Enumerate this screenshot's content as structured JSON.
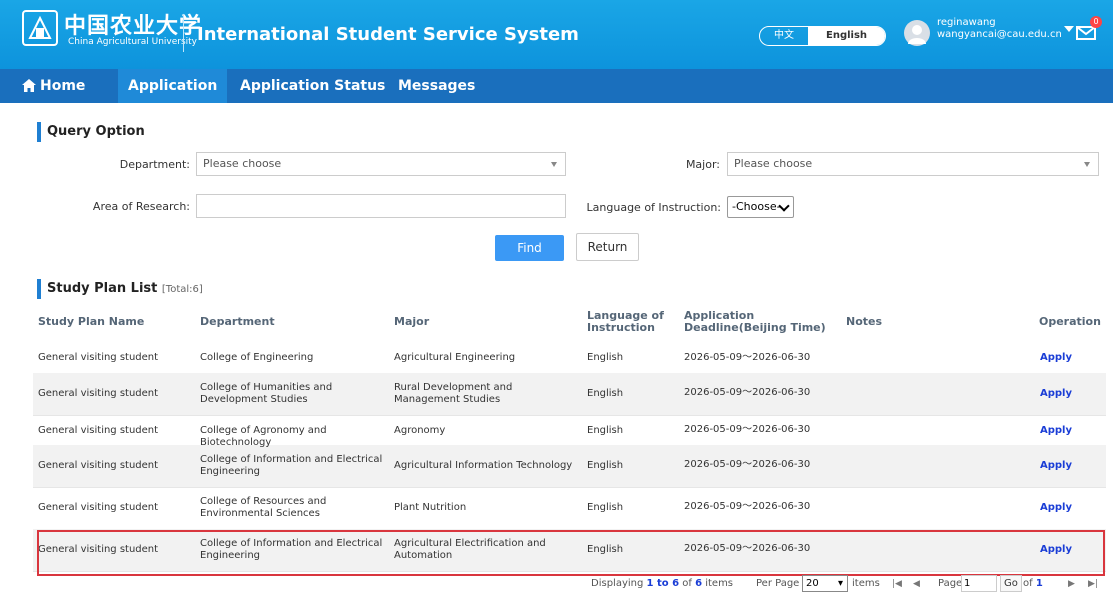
{
  "header": {
    "university_cn": "中国农业大学",
    "university_en": "China Agricultural University",
    "system_title": "International Student Service System",
    "lang_options": [
      "中文",
      "English"
    ],
    "lang_active": "English",
    "user_name": "reginawang",
    "user_email": "wangyancai@cau.edu.cn",
    "message_count": "0"
  },
  "nav": {
    "items": [
      "Home",
      "Application",
      "Application Status",
      "Messages"
    ],
    "active": "Application"
  },
  "query": {
    "title": "Query Option",
    "department_label": "Department:",
    "department_value": "Please choose",
    "major_label": "Major:",
    "major_value": "Please choose",
    "area_label": "Area of Research:",
    "area_value": "",
    "language_label": "Language of Instruction:",
    "language_value": "-Choose-",
    "find_label": "Find",
    "return_label": "Return"
  },
  "list": {
    "title": "Study Plan List",
    "total": "[Total:6]",
    "columns": [
      "Study Plan Name",
      "Department",
      "Major",
      "Language of Instruction",
      "Application Deadline(Beijing Time)",
      "Notes",
      "Operation"
    ],
    "rows": [
      {
        "name": "General visiting student",
        "department": "College of Engineering",
        "major": "Agricultural Engineering",
        "language": "English",
        "deadline": "2026-05-09～2026-06-30",
        "notes": "",
        "operation": "Apply"
      },
      {
        "name": "General visiting student",
        "department": "College of Humanities and Development Studies",
        "major": "Rural Development and Management Studies",
        "language": "English",
        "deadline": "2026-05-09～2026-06-30",
        "notes": "",
        "operation": "Apply"
      },
      {
        "name": "General visiting student",
        "department": "College of Agronomy and Biotechnology",
        "major": "Agronomy",
        "language": "English",
        "deadline": "2026-05-09～2026-06-30",
        "notes": "",
        "operation": "Apply"
      },
      {
        "name": "General visiting student",
        "department": "College of Information and Electrical Engineering",
        "major": "Agricultural Information Technology",
        "language": "English",
        "deadline": "2026-05-09～2026-06-30",
        "notes": "",
        "operation": "Apply"
      },
      {
        "name": "General visiting student",
        "department": "College of Resources and Environmental Sciences",
        "major": "Plant Nutrition",
        "language": "English",
        "deadline": "2026-05-09～2026-06-30",
        "notes": "",
        "operation": "Apply"
      },
      {
        "name": "General visiting student",
        "department": "College of Information and Electrical Engineering",
        "major": "Agricultural Electrification and Automation",
        "language": "English",
        "deadline": "2026-05-09～2026-06-30",
        "notes": "",
        "operation": "Apply"
      }
    ]
  },
  "pager": {
    "displaying_prefix": "Displaying",
    "range": "1 to 6",
    "of_text": "of",
    "count": "6",
    "items_text": "items",
    "per_page_label": "Per Page",
    "per_page_value": "20",
    "items_label": "items",
    "page_label": "Page",
    "page_value": "1",
    "go_label": "Go",
    "of_label": "of",
    "total_pages": "1"
  },
  "colors": {
    "header_bg": "#0d93dc",
    "nav_bg": "#1a6fbd",
    "nav_active_bg": "#1f8ad8",
    "find_button": "#3b99f5",
    "link": "#1a3dd6",
    "highlight_border": "#d9363e"
  }
}
